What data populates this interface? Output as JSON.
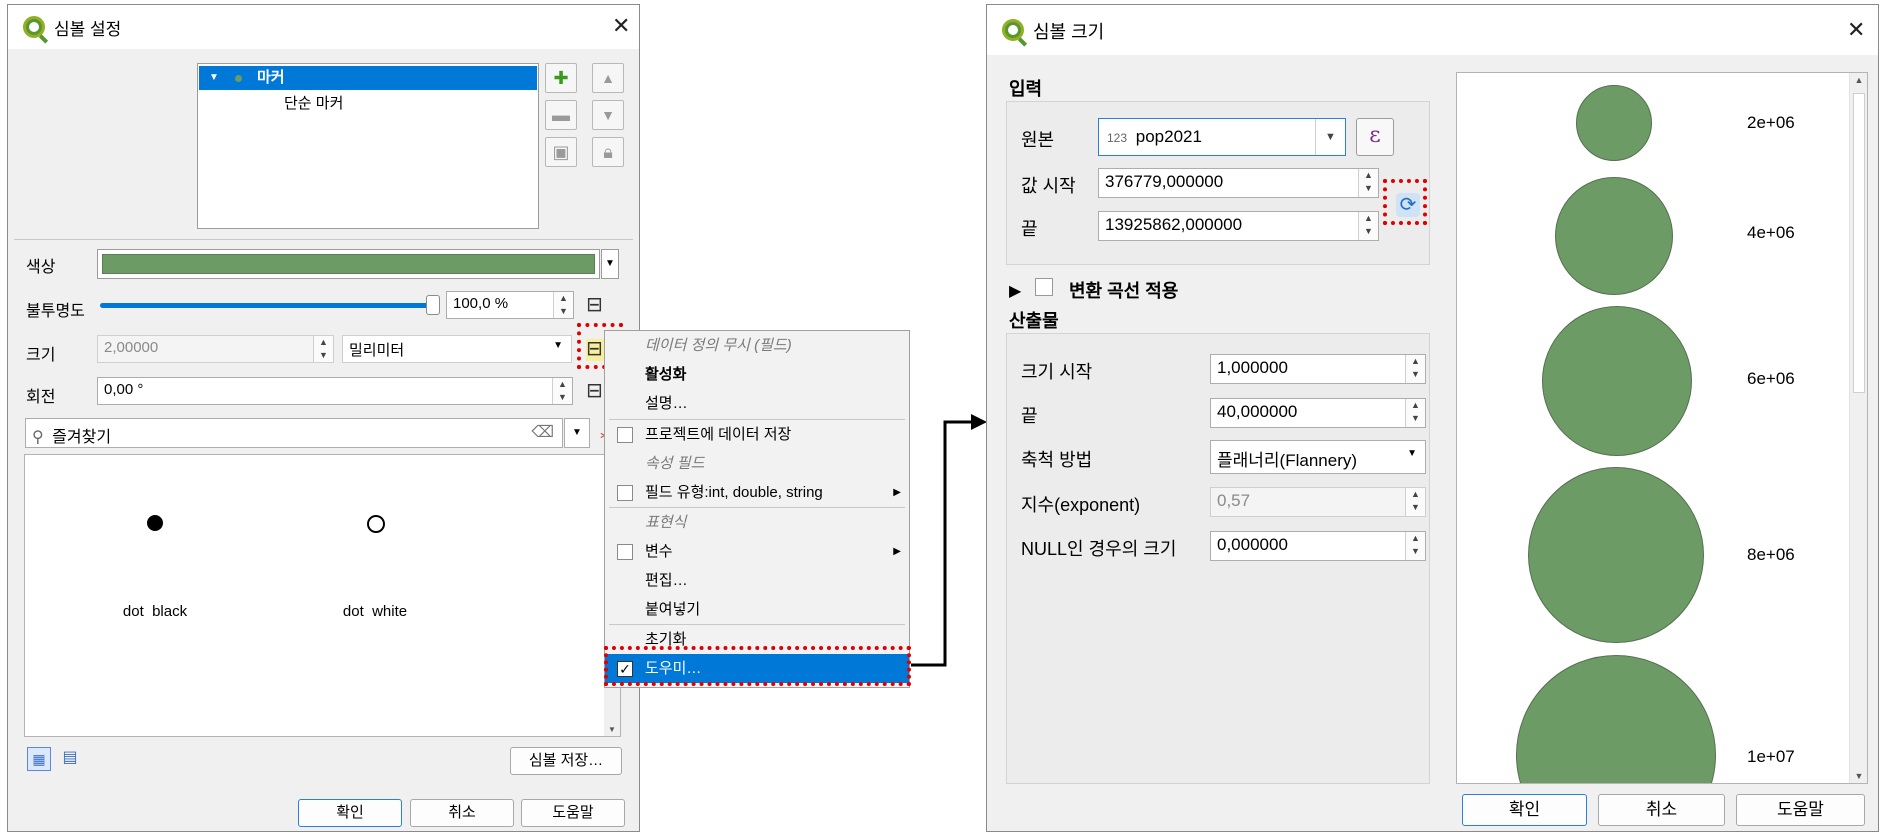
{
  "left_dialog": {
    "title": "심볼 설정",
    "tree": {
      "root": "마커",
      "child": "단순 마커"
    },
    "color_label": "색상",
    "opacity_label": "불투명도",
    "opacity_value": "100,0 %",
    "size_label": "크기",
    "size_value": "2,00000",
    "unit_value": "밀리미터",
    "rotation_label": "회전",
    "rotation_value": "0,00 °",
    "search_placeholder": "즐겨찾기",
    "symbols": [
      {
        "name": "dot  black"
      },
      {
        "name": "dot  white"
      }
    ],
    "save_symbol": "심볼 저장…",
    "ok": "확인",
    "cancel": "취소",
    "help": "도움말"
  },
  "context_menu": {
    "header_override": "데이터 정의 무시 (필드)",
    "activate": "활성화",
    "description": "설명…",
    "store_in_project": "프로젝트에 데이터 저장",
    "header_attr_field": "속성 필드",
    "field_type": "필드 유형:int, double, string",
    "header_expression": "표현식",
    "variable": "변수",
    "edit": "편집…",
    "paste": "붙여넣기",
    "reset": "초기화",
    "assistant": "도우미…"
  },
  "right_dialog": {
    "title": "심볼 크기",
    "input_section": "입력",
    "source_label": "원본",
    "source_type": "123",
    "source_value": "pop2021",
    "value_from_label": "값 시작",
    "value_from": "376779,000000",
    "value_to_label": "끝",
    "value_to": "13925862,000000",
    "transform_curve": "변환 곡선 적용",
    "output_section": "산출물",
    "size_from_label": "크기 시작",
    "size_from": "1,000000",
    "size_to_label": "끝",
    "size_to": "40,000000",
    "scale_method_label": "축척 방법",
    "scale_method": "플래너리(Flannery)",
    "exponent_label": "지수(exponent)",
    "exponent": "0,57",
    "null_size_label": "NULL인 경우의 크기",
    "null_size": "0,000000",
    "preview_labels": [
      "2e+06",
      "4e+06",
      "6e+06",
      "8e+06",
      "1e+07"
    ],
    "ok": "확인",
    "cancel": "취소",
    "help": "도움말"
  },
  "colors": {
    "symbol_fill": "#6d9b66",
    "highlight": "#0078d7",
    "callout": "#e00000"
  }
}
